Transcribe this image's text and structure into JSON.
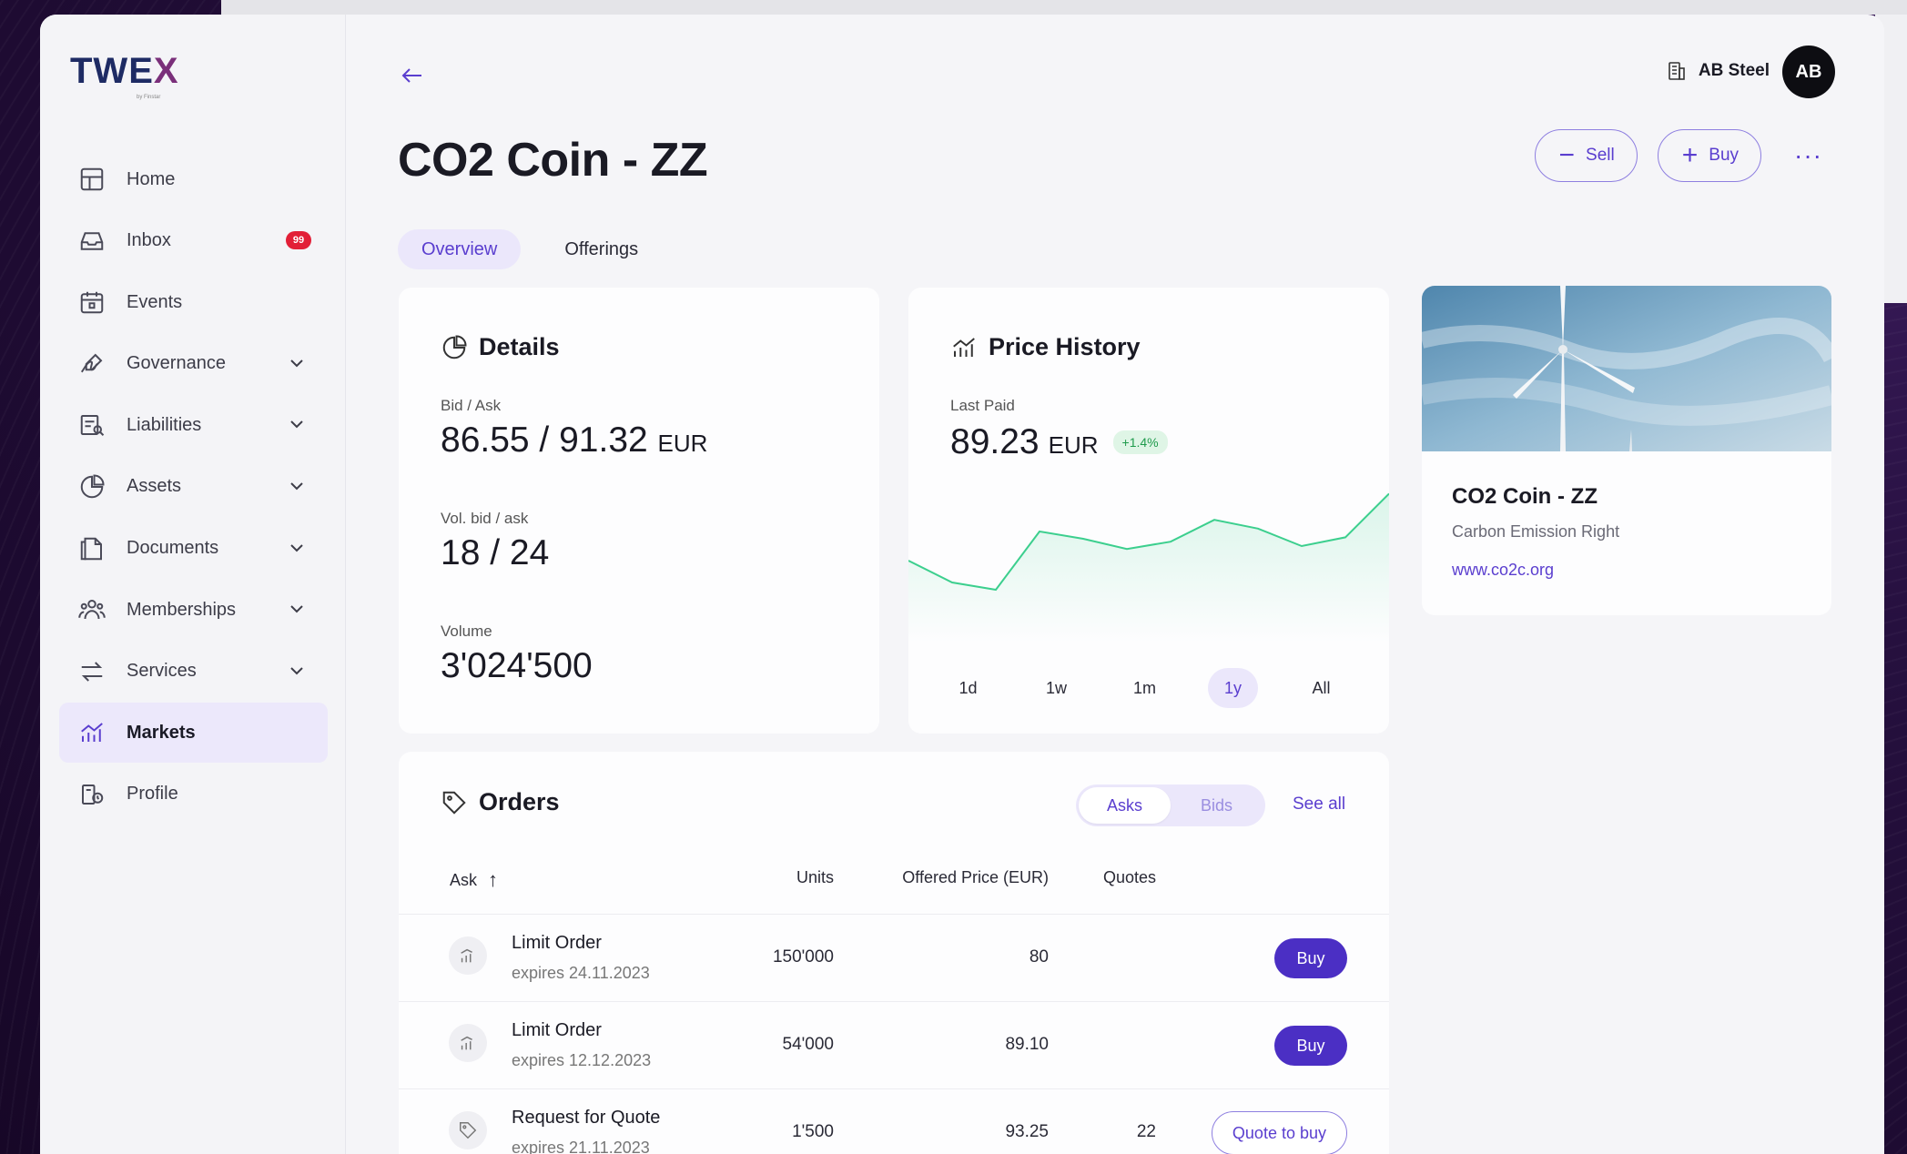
{
  "app": {
    "logo": "TWE",
    "logo_x": "X",
    "logo_sub": "by Finstar"
  },
  "sidebar": {
    "items": [
      {
        "label": "Home",
        "icon": "dashboard-icon"
      },
      {
        "label": "Inbox",
        "icon": "inbox-icon",
        "badge": "99"
      },
      {
        "label": "Events",
        "icon": "calendar-icon"
      },
      {
        "label": "Governance",
        "icon": "signature-icon"
      },
      {
        "label": "Liabilities",
        "icon": "liabilities-icon"
      },
      {
        "label": "Assets",
        "icon": "pie-chart-icon"
      },
      {
        "label": "Documents",
        "icon": "document-icon"
      },
      {
        "label": "Memberships",
        "icon": "people-icon"
      },
      {
        "label": "Services",
        "icon": "swap-icon"
      },
      {
        "label": "Markets",
        "icon": "markets-icon"
      },
      {
        "label": "Profile",
        "icon": "profile-icon"
      }
    ]
  },
  "header": {
    "org_name": "AB Steel",
    "avatar_initials": "AB",
    "title": "CO2 Coin - ZZ",
    "sell_label": "Sell",
    "buy_label": "Buy",
    "more_label": "···"
  },
  "tabs": {
    "overview": "Overview",
    "offerings": "Offerings"
  },
  "details": {
    "title": "Details",
    "bid_ask_label": "Bid / Ask",
    "bid_ask_value": "86.55 / 91.32",
    "currency": "EUR",
    "vol_label": "Vol. bid / ask",
    "vol_value": "18 / 24",
    "volume_label": "Volume",
    "volume_value": "3'024'500"
  },
  "price_history": {
    "title": "Price History",
    "last_paid_label": "Last Paid",
    "last_paid_value": "89.23",
    "currency": "EUR",
    "change": "+1.4%",
    "ranges": [
      "1d",
      "1w",
      "1m",
      "1y",
      "All"
    ],
    "active_range": "1y"
  },
  "chart_data": {
    "type": "line",
    "x": [
      0,
      1,
      2,
      3,
      4,
      5,
      6,
      7,
      8,
      9,
      10
    ],
    "values": [
      50,
      35,
      30,
      70,
      65,
      58,
      63,
      78,
      72,
      60,
      66
    ],
    "series_end": 96,
    "ylim": [
      0,
      100
    ],
    "color": "#3ccf8e"
  },
  "asset": {
    "name": "CO2 Coin - ZZ",
    "type": "Carbon Emission Right",
    "link": "www.co2c.org"
  },
  "orders": {
    "title": "Orders",
    "seg_asks": "Asks",
    "seg_bids": "Bids",
    "see_all": "See all",
    "columns": {
      "ask": "Ask",
      "units": "Units",
      "price": "Offered Price (EUR)",
      "quotes": "Quotes"
    },
    "rows": [
      {
        "title": "Limit Order",
        "sub": "expires 24.11.2023",
        "units": "150'000",
        "price": "80",
        "quotes": "",
        "action": "Buy"
      },
      {
        "title": "Limit Order",
        "sub": "expires 12.12.2023",
        "units": "54'000",
        "price": "89.10",
        "quotes": "",
        "action": "Buy"
      },
      {
        "title": "Request for Quote",
        "sub": "expires 21.11.2023",
        "units": "1'500",
        "price": "93.25",
        "quotes": "22",
        "action": "Quote to buy"
      }
    ]
  },
  "colors": {
    "accent": "#5a3ecf",
    "buy_button": "#4b2fc4",
    "badge": "#e21f37",
    "positive": "#1f9b4c"
  }
}
